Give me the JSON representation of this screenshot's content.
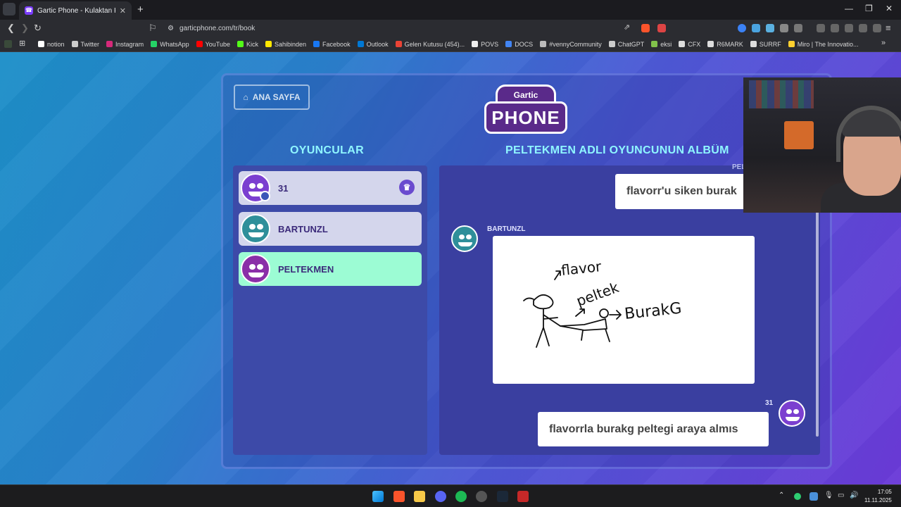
{
  "browser": {
    "tab_title": "Gartic Phone - Kulaktan Kulağa",
    "url": "garticphone.com/tr/book"
  },
  "bookmarks": [
    {
      "label": "notion",
      "color": "#ffffff"
    },
    {
      "label": "Twitter",
      "color": "#cccccc"
    },
    {
      "label": "Instagram",
      "color": "#d6297a"
    },
    {
      "label": "WhatsApp",
      "color": "#25d366"
    },
    {
      "label": "YouTube",
      "color": "#ff0000"
    },
    {
      "label": "Kick",
      "color": "#53fc18"
    },
    {
      "label": "Sahibinden",
      "color": "#ffe800"
    },
    {
      "label": "Facebook",
      "color": "#1877f2"
    },
    {
      "label": "Outlook",
      "color": "#0078d4"
    },
    {
      "label": "Gelen Kutusu (454)...",
      "color": "#ea4335"
    },
    {
      "label": "POVS",
      "color": "#eeeeee"
    },
    {
      "label": "DOCS",
      "color": "#4285f4"
    },
    {
      "label": "#vennyCommunity",
      "color": "#bbbbbb"
    },
    {
      "label": "ChatGPT",
      "color": "#cccccc"
    },
    {
      "label": "eksi",
      "color": "#81c14b"
    },
    {
      "label": "CFX",
      "color": "#dddddd"
    },
    {
      "label": "R6MARK",
      "color": "#dddddd"
    },
    {
      "label": "SURRF",
      "color": "#dddddd"
    },
    {
      "label": "Miro | The Innovatio...",
      "color": "#ffd02f"
    }
  ],
  "game": {
    "home_button": "ANA SAYFA",
    "logo_top": "Gartic",
    "logo_main": "PHONE",
    "players_heading": "OYUNCULAR",
    "album_heading": "PELTEKMEN ADLI OYUNCUNUN ALBÜM",
    "players": [
      {
        "name": "31",
        "avatar_color": "#7b3fd0",
        "host": true,
        "selected": false
      },
      {
        "name": "BARTUNZL",
        "avatar_color": "#2f8f9a",
        "host": false,
        "selected": false
      },
      {
        "name": "PELTEKMEN",
        "avatar_color": "#8a2fa8",
        "host": false,
        "selected": true
      }
    ],
    "album": {
      "top_name_partial": "PEL",
      "first_message": "flavorr'u siken burak",
      "drawing_author": "BARTUNZL",
      "drawing_texts": [
        "flavor",
        "peltek",
        "BurakG"
      ],
      "reply_author": "31",
      "reply_message": "flavorrla burakg peltegi araya almıs"
    }
  },
  "taskbar": {
    "time": "17:05",
    "date": "11.11.2025"
  }
}
